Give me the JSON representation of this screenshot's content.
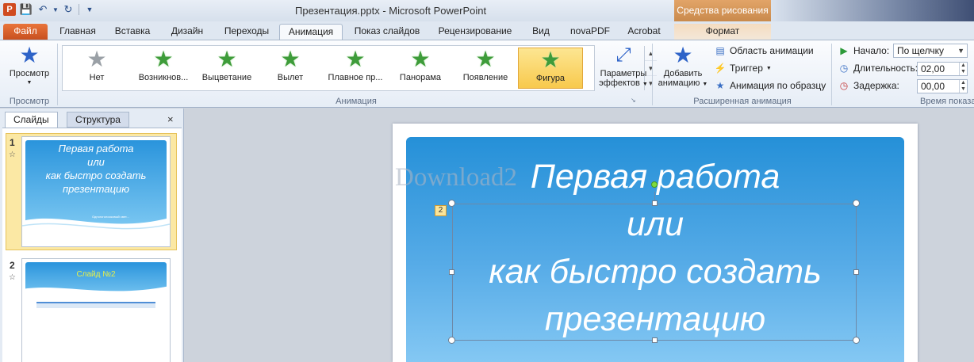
{
  "window": {
    "title": "Презентация.pptx - Microsoft PowerPoint",
    "contextual_header": "Средства рисования"
  },
  "tabs": [
    {
      "label": "Файл"
    },
    {
      "label": "Главная"
    },
    {
      "label": "Вставка"
    },
    {
      "label": "Дизайн"
    },
    {
      "label": "Переходы"
    },
    {
      "label": "Анимация"
    },
    {
      "label": "Показ слайдов"
    },
    {
      "label": "Рецензирование"
    },
    {
      "label": "Вид"
    },
    {
      "label": "novaPDF"
    },
    {
      "label": "Acrobat"
    },
    {
      "label": "Формат"
    }
  ],
  "ribbon": {
    "preview": {
      "button": "Просмотр",
      "group": "Просмотр"
    },
    "animation_group": "Анимация",
    "animations": [
      {
        "label": "Нет",
        "icon": "star-gray-icon"
      },
      {
        "label": "Возникнов...",
        "icon": "star-appear-icon"
      },
      {
        "label": "Выцветание",
        "icon": "star-fade-icon"
      },
      {
        "label": "Вылет",
        "icon": "star-fly-icon"
      },
      {
        "label": "Плавное пр...",
        "icon": "star-float-icon"
      },
      {
        "label": "Панорама",
        "icon": "star-split-icon"
      },
      {
        "label": "Появление",
        "icon": "star-wipe-icon"
      },
      {
        "label": "Фигура",
        "icon": "star-shape-icon",
        "selected": true
      }
    ],
    "effect_options": {
      "line1": "Параметры",
      "line2": "эффектов"
    },
    "advanced": {
      "add_line1": "Добавить",
      "add_line2": "анимацию",
      "pane": "Область анимации",
      "trigger": "Триггер",
      "painter": "Анимация по образцу",
      "group": "Расширенная анимация"
    },
    "timing": {
      "start_label": "Начало:",
      "start_value": "По щелчку",
      "duration_label": "Длительность:",
      "duration_value": "02,00",
      "delay_label": "Задержка:",
      "delay_value": "00,00",
      "group": "Время показа"
    }
  },
  "slides_pane": {
    "tab_slides": "Слайды",
    "tab_outline": "Структура",
    "close": "×",
    "slides": [
      {
        "number": "1",
        "title_lines": [
          "Первая работа",
          "или",
          "как быстро создать",
          "презентацию"
        ],
        "subtitle": "Одногоголосковый свет..."
      },
      {
        "number": "2",
        "title": "Слайд №2",
        "table": {
          "headers": [
            "",
            "",
            ""
          ],
          "rows": [
            [
              "",
              "",
              ""
            ],
            [
              "",
              "",
              ""
            ],
            [
              "",
              "",
              ""
            ]
          ]
        }
      }
    ]
  },
  "slide": {
    "title_lines": [
      "Первая работа",
      "или",
      "как быстро создать",
      "презентацию"
    ],
    "animation_tag": "2",
    "watermark": "Download2"
  }
}
